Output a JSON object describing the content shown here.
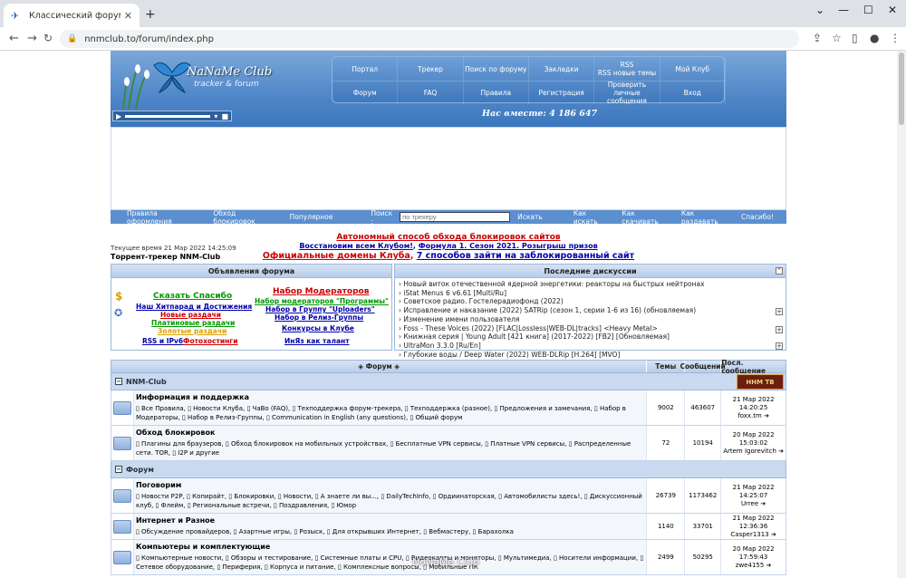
{
  "browser": {
    "tab_title": "Классический форум-трекер - NNM-Club",
    "url": "nnmclub.to/forum/index.php"
  },
  "header": {
    "logo_text": "NaNaMe Club",
    "logo_sub": "tracker & forum",
    "menu_top": [
      "Портал",
      "Трекер",
      "Поиск по форуму",
      "Закладки",
      "RSS\nRSS новые темы",
      "Мой Клуб"
    ],
    "menu_bottom": [
      "Форум",
      "FAQ",
      "Правила",
      "Регистрация",
      "Проверить личные сообщения",
      "Вход"
    ],
    "together": "Нас вместе: 4 186 647"
  },
  "navbar": {
    "left": [
      "Правила оформления",
      "Обход блокировок",
      "Популярное"
    ],
    "search_label": "Поиск :",
    "search_placeholder": "по трекеру",
    "search_button": "Искать",
    "right": [
      "Как искать",
      "Как скачивать",
      "Как раздавать",
      "Спасибо!"
    ]
  },
  "promo": {
    "line1": "Автономный способ обхода блокировок сайтов",
    "line2a": "Восстановим всем Клубом!",
    "line2b": "Формула 1. Сезон 2021. Розыгрыш призов",
    "line3a": "Официальные домены Клуба",
    "line3b": "7 способов зайти на заблокированный сайт"
  },
  "current_time": "Текущее время 21 Мар 2022 14:25:09",
  "tracker_name": "Торрент-трекер NNM-Club",
  "announcements": {
    "title": "Объявления форума",
    "say_thanks": "Сказать Спасибо",
    "hitparade": "Наш Хитпарад и Достижения",
    "new_releases": "Новые раздачи",
    "paid_releases": "Платиновые раздачи",
    "gold_releases": "Золотые раздачи",
    "rss": "RSS и IPv6",
    "photohosting": "Фотохостинги",
    "moderators": "Набор Модераторов",
    "mod_programs": "Набор модераторов \"Программы\"",
    "uploaders": "Набор в Группу \"Uploaders\"",
    "release_group": "Набор в Релиз-Группы",
    "contests": "Конкурсы в Клубе",
    "talent": "ИнЯз как талант"
  },
  "discussions": {
    "title": "Последние дискуссии",
    "items": [
      "› Новый виток отечественной ядерной энергетики: реакторы на быстрых нейтронах",
      "› iStat Menus 6 v6.61 [Multi/Ru]",
      "› Советское радио. Гостелерадиофонд (2022)",
      "› Исправление и наказание (2022) SATRip (сезон 1, серии 1-6 из 16) (обновляемая)",
      "› Изменение имени пользователя",
      "› Foss - These Voices (2022) [FLAC|Lossless|WEB-DL|tracks] <Heavy Metal>",
      "› Книжная серия | Young Adult [421 книга] (2017-2022) [FB2] [Обновляемая]",
      "› UltraMon 3.3.0 [Ru/En]",
      "› Глубокие воды / Deep Water (2022) WEB-DLRip [H.264] [MVO]"
    ]
  },
  "forum": {
    "headers": {
      "forum": "Форум",
      "topics": "Темы",
      "posts": "Сообщений",
      "last": "Посл. сообщение"
    },
    "categories": [
      {
        "name": "NNM-Club",
        "badge": "ННМ ТВ",
        "rows": [
          {
            "title": "Информация и поддержка",
            "subs": "Все Правила, Новости Клуба, ЧаВо (FAQ), Техподдержка форум-трекера, Техподдержка (разное), Предложения и замечания, Набор в Модераторы, Набор в Релиз-Группы, Communication in English (any questions), Общий форум",
            "topics": "9002",
            "posts": "463607",
            "date": "21 Мар 2022 14:20:25",
            "user": "foxx.tm"
          },
          {
            "title": "Обход блокировок",
            "subs": "Плагины для браузеров, Обход блокировок на мобильных устройствах, Бесплатные VPN сервисы, Платные VPN сервисы, Распределенные сети. TOR, I2P и другие",
            "topics": "72",
            "posts": "10194",
            "date": "20 Мар 2022 15:03:02",
            "user": "Artem Igorevitch"
          }
        ]
      },
      {
        "name": "Форум",
        "badge": "",
        "rows": [
          {
            "title": "Поговорим",
            "subs": "Новости P2P, Копирайт, Блокировки, Новости, А знаете ли вы..., DailyTechInfo, Ордиинаторская, Автомобилисты здесь!, Дискуссионный клуб, Флейм, Региональные встречи, Поздравления, Юмор",
            "topics": "26739",
            "posts": "1173462",
            "date": "21 Мар 2022 14:25:07",
            "user": "Urree"
          },
          {
            "title": "Интернет и Разное",
            "subs": "Обсуждение провайдеров, Азартные игры, Розыск, Для открывших Интернет, Вебмастеру, Барахолка",
            "topics": "1140",
            "posts": "33701",
            "date": "21 Мар 2022 12:36:36",
            "user": "Casper1313"
          },
          {
            "title": "Компьютеры и комплектующие",
            "subs": "Компьютерные новости, Обзоры и тестирование, Системные платы и CPU, Видеокарты и мониторы, Мультимедиа, Носители информации, Сетевое оборудование, Периферия, Корпуса и питание, Комплексные вопросы, Мобильные ПК",
            "topics": "2499",
            "posts": "50295",
            "date": "20 Мар 2022 17:59:43",
            "user": "zwe4155"
          }
        ]
      }
    ]
  },
  "watermark": "NoNaMe Club"
}
